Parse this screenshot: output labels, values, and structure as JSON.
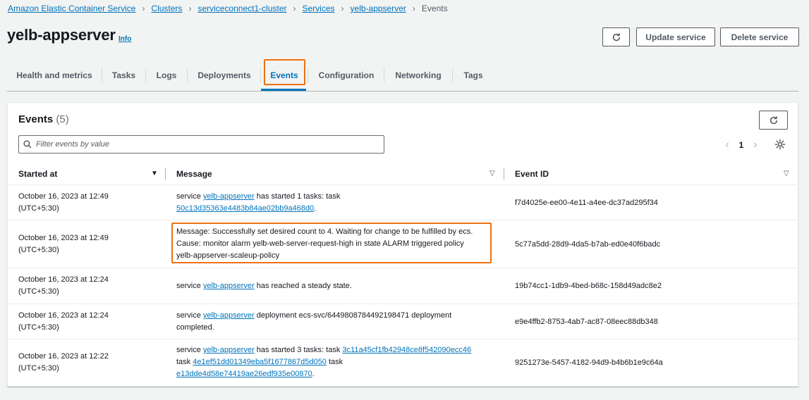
{
  "breadcrumb": {
    "items": [
      "Amazon Elastic Container Service",
      "Clusters",
      "serviceconnect1-cluster",
      "Services",
      "yelb-appserver"
    ],
    "current": "Events"
  },
  "header": {
    "title": "yelb-appserver",
    "info_label": "Info",
    "update_label": "Update service",
    "delete_label": "Delete service"
  },
  "tabs": [
    {
      "label": "Health and metrics"
    },
    {
      "label": "Tasks"
    },
    {
      "label": "Logs"
    },
    {
      "label": "Deployments"
    },
    {
      "label": "Events",
      "active": true
    },
    {
      "label": "Configuration"
    },
    {
      "label": "Networking"
    },
    {
      "label": "Tags"
    }
  ],
  "events": {
    "title": "Events",
    "count": "(5)",
    "filter_placeholder": "Filter events by value",
    "page": "1",
    "columns": {
      "started_at": "Started at",
      "message": "Message",
      "event_id": "Event ID"
    },
    "rows": [
      {
        "date": "October 16, 2023 at 12:49",
        "tz": "(UTC+5:30)",
        "msg": {
          "l1_pre": "service ",
          "l1_link": "yelb-appserver",
          "l1_post": " has started 1 tasks: task",
          "l2_link": "50c13d35363e4483b84ae02bb9a468d0",
          "l2_post": "."
        },
        "event_id": "f7d4025e-ee00-4e11-a4ee-dc37ad295f34"
      },
      {
        "date": "October 16, 2023 at 12:49",
        "tz": "(UTC+5:30)",
        "msg": {
          "l1": "Message: Successfully set desired count to 4. Waiting for change to be fulfilled by ecs.",
          "l2": "Cause: monitor alarm yelb-web-server-request-high in state ALARM triggered policy",
          "l3": "yelb-appserver-scaleup-policy"
        },
        "event_id": "5c77a5dd-28d9-4da5-b7ab-ed0e40f6badc"
      },
      {
        "date": "October 16, 2023 at 12:24",
        "tz": "(UTC+5:30)",
        "msg": {
          "l1_pre": "service ",
          "l1_link": "yelb-appserver",
          "l1_post": " has reached a steady state."
        },
        "event_id": "19b74cc1-1db9-4bed-b68c-158d49adc8e2"
      },
      {
        "date": "October 16, 2023 at 12:24",
        "tz": "(UTC+5:30)",
        "msg": {
          "l1_pre": "service ",
          "l1_link": "yelb-appserver",
          "l1_post": " deployment ecs-svc/6449808784492198471 deployment",
          "l2": "completed."
        },
        "event_id": "e9e4ffb2-8753-4ab7-ac87-08eec88db348"
      },
      {
        "date": "October 16, 2023 at 12:22",
        "tz": "(UTC+5:30)",
        "msg": {
          "l1_pre": "service ",
          "l1_link": "yelb-appserver",
          "l1_post": " has started 3 tasks: task ",
          "l1_link2": "3c11a45cf1fb42948ce8f542090ecc46",
          "l2_pre": "task ",
          "l2_link": "4e1ef51dd01349eba5f1677867d5d050",
          "l2_post": " task",
          "l3_link": "e13dde4d58e74419ae26edf935e00870",
          "l3_post": "."
        },
        "event_id": "9251273e-5457-4182-94d9-b4b6b1e9c64a"
      }
    ]
  },
  "colors": {
    "link": "#0073bb",
    "highlight": "#ec7211",
    "background": "#f2f3f3"
  }
}
